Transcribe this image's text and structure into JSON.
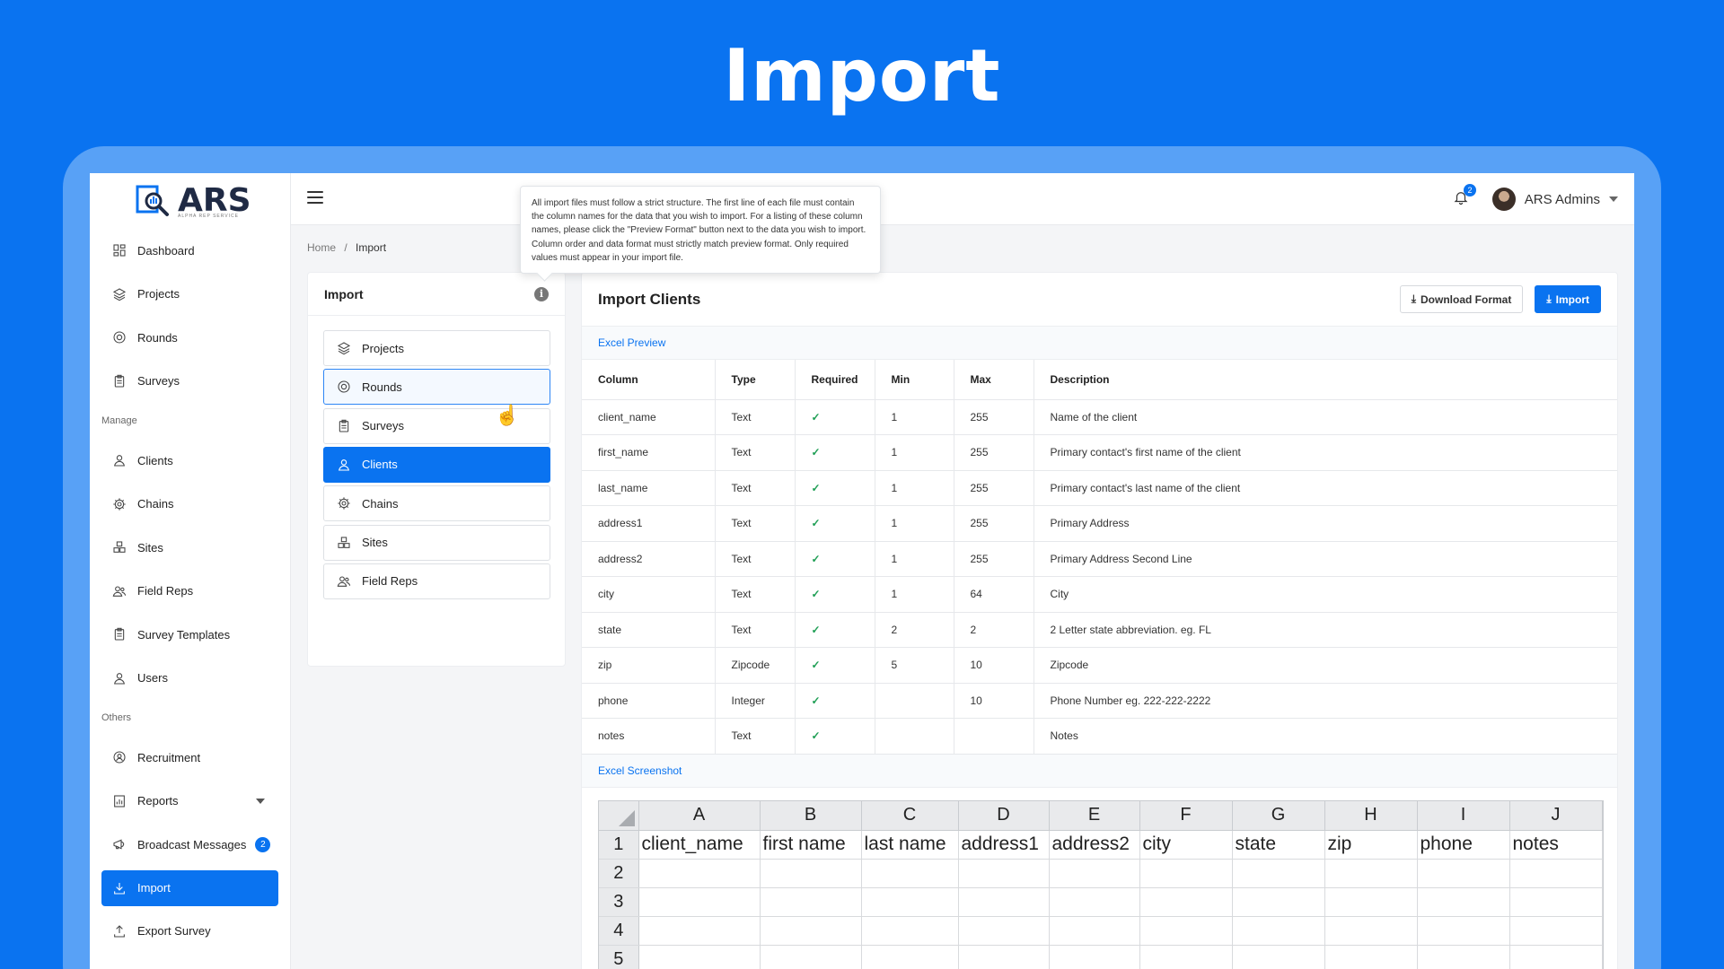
{
  "hero_title": "Import",
  "logo": {
    "text": "ARS",
    "subtitle": "ALPHA REP SERVICE"
  },
  "sidebar": {
    "items_top": [
      {
        "label": "Dashboard",
        "icon": "dashboard-icon"
      },
      {
        "label": "Projects",
        "icon": "layers-icon"
      },
      {
        "label": "Rounds",
        "icon": "target-icon"
      },
      {
        "label": "Surveys",
        "icon": "clipboard-icon"
      }
    ],
    "section_manage": "Manage",
    "items_manage": [
      {
        "label": "Clients",
        "icon": "user-icon"
      },
      {
        "label": "Chains",
        "icon": "gear-icon"
      },
      {
        "label": "Sites",
        "icon": "cubes-icon"
      },
      {
        "label": "Field Reps",
        "icon": "users-icon"
      },
      {
        "label": "Survey Templates",
        "icon": "clipboard-icon"
      },
      {
        "label": "Users",
        "icon": "user-icon"
      }
    ],
    "section_others": "Others",
    "items_others": [
      {
        "label": "Recruitment",
        "icon": "recruit-icon"
      },
      {
        "label": "Reports",
        "icon": "report-icon"
      },
      {
        "label": "Broadcast Messages",
        "icon": "megaphone-icon",
        "badge": "2"
      },
      {
        "label": "Import",
        "icon": "download-icon",
        "active": true
      },
      {
        "label": "Export Survey",
        "icon": "upload-icon"
      }
    ]
  },
  "topbar": {
    "notification_count": "2",
    "user_name": "ARS Admins"
  },
  "tooltip": "All import files must follow a strict structure. The first line of each file must contain the column names for the data that you wish to import. For a listing of these column names, please click the \"Preview Format\" button next to the data you wish to import. Column order and data format must strictly match preview format. Only required values must appear in your import file.",
  "breadcrumb": {
    "home": "Home",
    "separator": "/",
    "current": "Import"
  },
  "import_panel": {
    "title": "Import",
    "options": [
      "Projects",
      "Rounds",
      "Surveys",
      "Clients",
      "Chains",
      "Sites",
      "Field Reps"
    ],
    "selected": "Clients",
    "hovered": "Rounds"
  },
  "main": {
    "title": "Import Clients",
    "download_label": "Download Format",
    "import_label": "Import",
    "excel_preview_label": "Excel Preview",
    "excel_screenshot_label": "Excel Screenshot",
    "columns": [
      "Column",
      "Type",
      "Required",
      "Min",
      "Max",
      "Description"
    ],
    "rows": [
      [
        "client_name",
        "Text",
        "✓",
        "1",
        "255",
        "Name of the client"
      ],
      [
        "first_name",
        "Text",
        "✓",
        "1",
        "255",
        "Primary contact's first name of the client"
      ],
      [
        "last_name",
        "Text",
        "✓",
        "1",
        "255",
        "Primary contact's last name of the client"
      ],
      [
        "address1",
        "Text",
        "✓",
        "1",
        "255",
        "Primary Address"
      ],
      [
        "address2",
        "Text",
        "✓",
        "1",
        "255",
        "Primary Address Second Line"
      ],
      [
        "city",
        "Text",
        "✓",
        "1",
        "64",
        "City"
      ],
      [
        "state",
        "Text",
        "✓",
        "2",
        "2",
        "2 Letter state abbreviation. eg. FL"
      ],
      [
        "zip",
        "Zipcode",
        "✓",
        "5",
        "10",
        "Zipcode"
      ],
      [
        "phone",
        "Integer",
        "✓",
        "",
        "10",
        "Phone Number eg. 222-222-2222"
      ],
      [
        "notes",
        "Text",
        "✓",
        "",
        "",
        "Notes"
      ]
    ]
  },
  "excel": {
    "col_headers": [
      "A",
      "B",
      "C",
      "D",
      "E",
      "F",
      "G",
      "H",
      "I",
      "J"
    ],
    "row_headers": [
      "1",
      "2",
      "3",
      "4",
      "5"
    ],
    "row1": [
      "client_name",
      "first name",
      "last name",
      "address1",
      "address2",
      "city",
      "state",
      "zip",
      "phone",
      "notes"
    ]
  },
  "colors": {
    "primary": "#0A73F0",
    "frame": "#58A1F6",
    "check": "#1E9E54"
  }
}
